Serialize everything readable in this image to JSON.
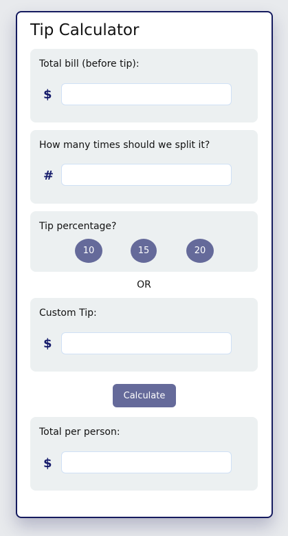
{
  "title": "Tip Calculator",
  "bill": {
    "label": "Total bill (before tip):",
    "symbol": "$",
    "value": "",
    "placeholder": ""
  },
  "split": {
    "label": "How many times should we split it?",
    "symbol": "#",
    "value": "",
    "placeholder": ""
  },
  "tip": {
    "label": "Tip percentage?",
    "options": [
      "10",
      "15",
      "20"
    ]
  },
  "or_label": "OR",
  "custom": {
    "label": "Custom Tip:",
    "symbol": "$",
    "value": "",
    "placeholder": ""
  },
  "calculate_label": "Calculate",
  "result": {
    "label": "Total per person:",
    "symbol": "$",
    "value": ""
  },
  "colors": {
    "accent": "#656a9a",
    "border": "#141a5e",
    "section_bg": "#ecf0f1"
  }
}
